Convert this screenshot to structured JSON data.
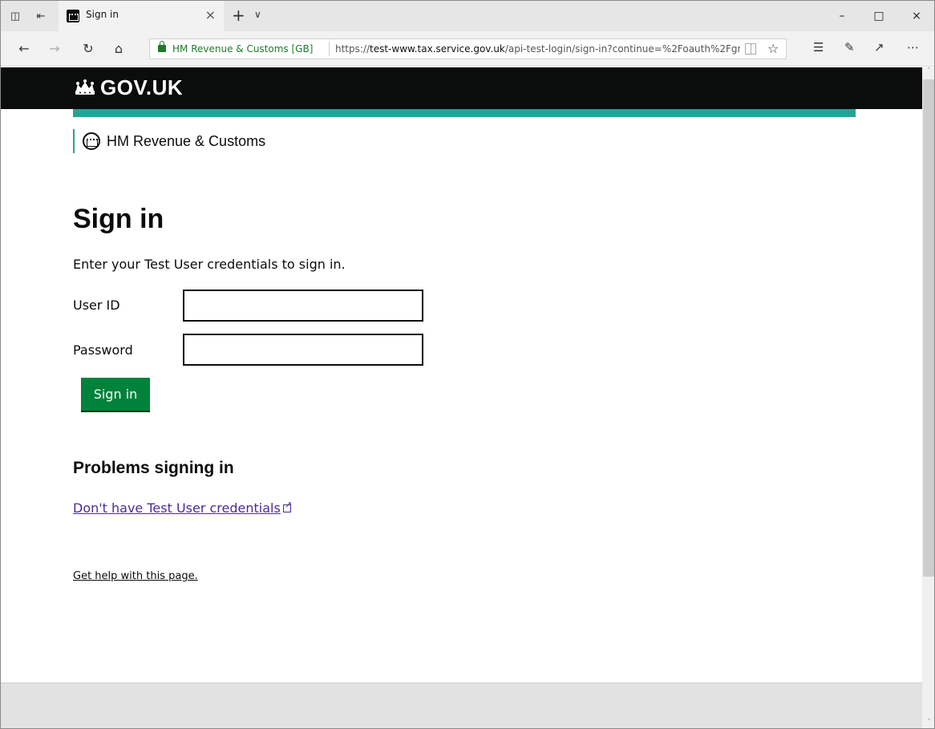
{
  "browser": {
    "tab": {
      "title": "Sign in"
    },
    "address": {
      "site_identity": "HM Revenue & Customs [GB]",
      "url_prefix": "https://",
      "url_host": "test-www.tax.service.gov.uk",
      "url_path": "/api-test-login/sign-in?continue=%2Foauth%2Fgra"
    }
  },
  "header": {
    "logo_text": "GOV.UK"
  },
  "organisation": {
    "name": "HM Revenue & Customs"
  },
  "main": {
    "heading": "Sign in",
    "lead": "Enter your Test User credentials to sign in.",
    "user_id_label": "User ID",
    "user_id_value": "",
    "password_label": "Password",
    "password_value": "",
    "signin_button": "Sign in",
    "problems_heading": "Problems signing in",
    "credentials_link": "Don't have Test User credentials",
    "help_link": "Get help with this page."
  },
  "colors": {
    "govuk_black": "#0b0c0c",
    "brand_teal": "#28a197",
    "button_green": "#00823b",
    "link_purple": "#4c2c92",
    "secure_green": "#1e7a2a"
  }
}
